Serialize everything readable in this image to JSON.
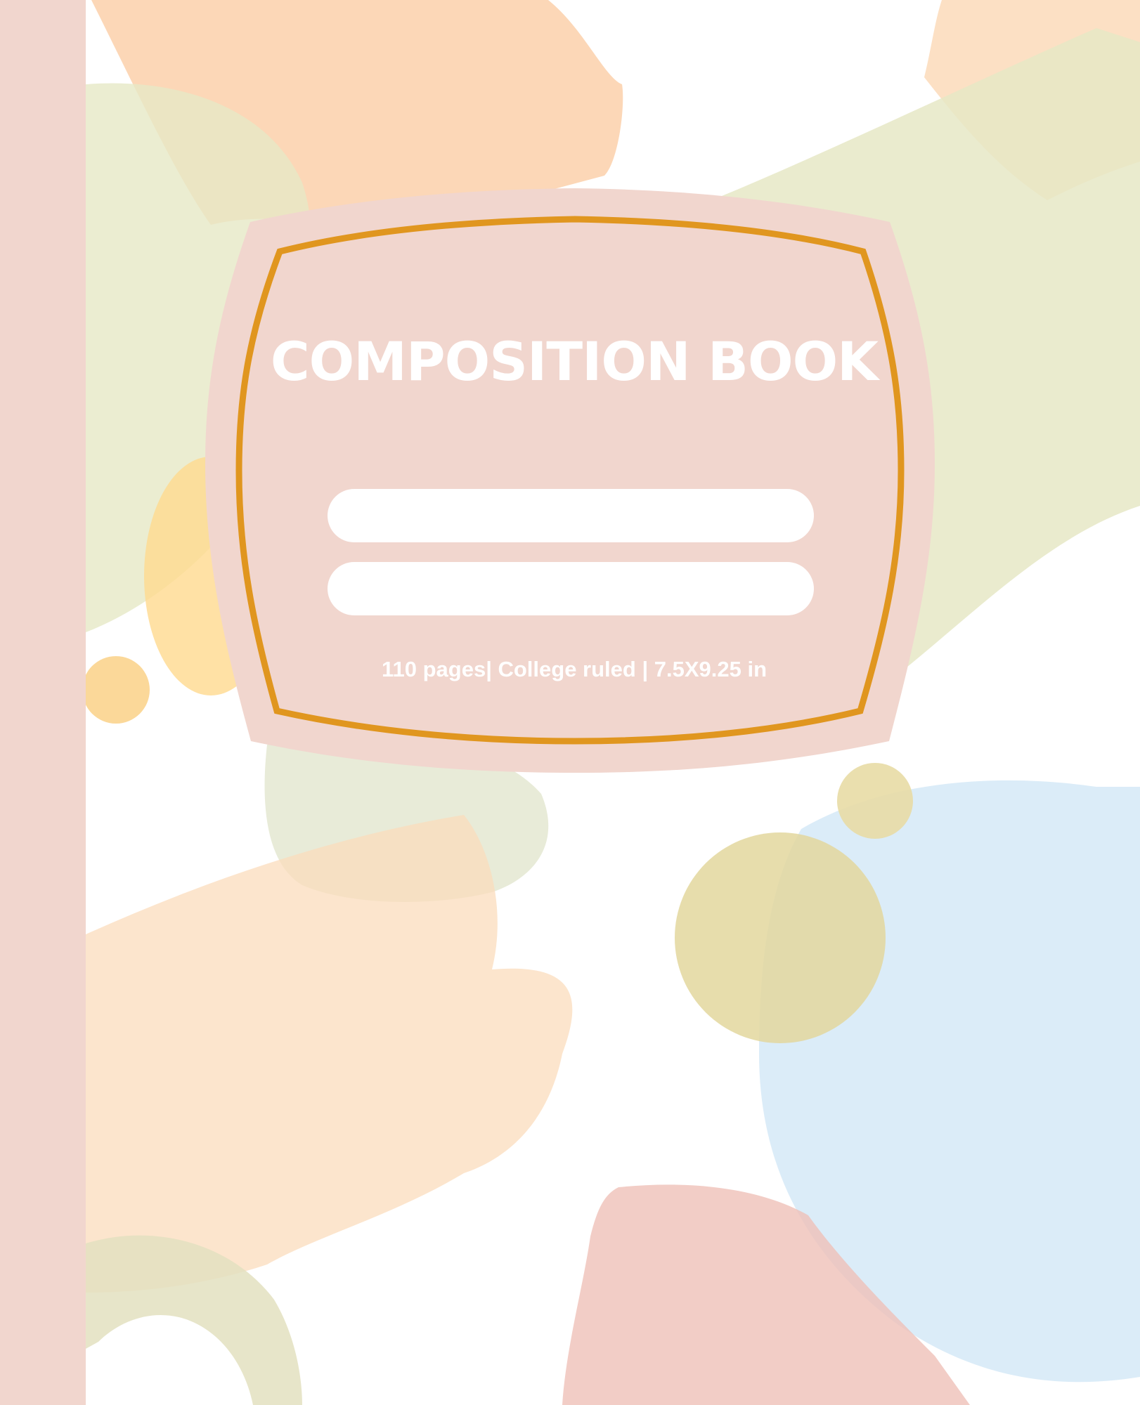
{
  "cover": {
    "title": "COMPOSITION BOOK",
    "info": "110 pages| College ruled | 7.5X9.25 in",
    "write_lines": 2
  },
  "colors": {
    "spine": "#f1d6ce",
    "label_fill": "#f1d6ce",
    "label_border": "#e0961f",
    "text": "#ffffff",
    "peach": "#fbd0aa",
    "sage": "#e6e8c6",
    "mustard": "#e5d49c",
    "sky": "#cfe6f5",
    "rose": "#efc1b8"
  }
}
